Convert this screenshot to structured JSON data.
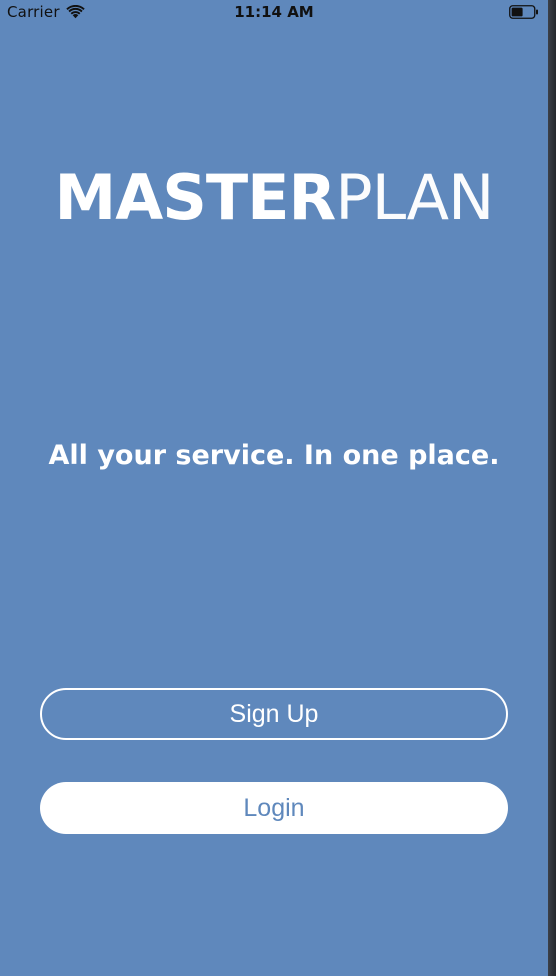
{
  "status_bar": {
    "carrier": "Carrier",
    "time": "11:14 AM",
    "wifi_icon": "wifi-icon",
    "battery_icon": "battery-icon"
  },
  "logo": {
    "bold_part": "MASTER",
    "light_part": "PLAN"
  },
  "tagline": "All your service. In one place.",
  "buttons": {
    "sign_up": "Sign Up",
    "login": "Login"
  },
  "colors": {
    "background": "#5f88bc",
    "text": "#ffffff",
    "login_text": "#5f88bc"
  }
}
